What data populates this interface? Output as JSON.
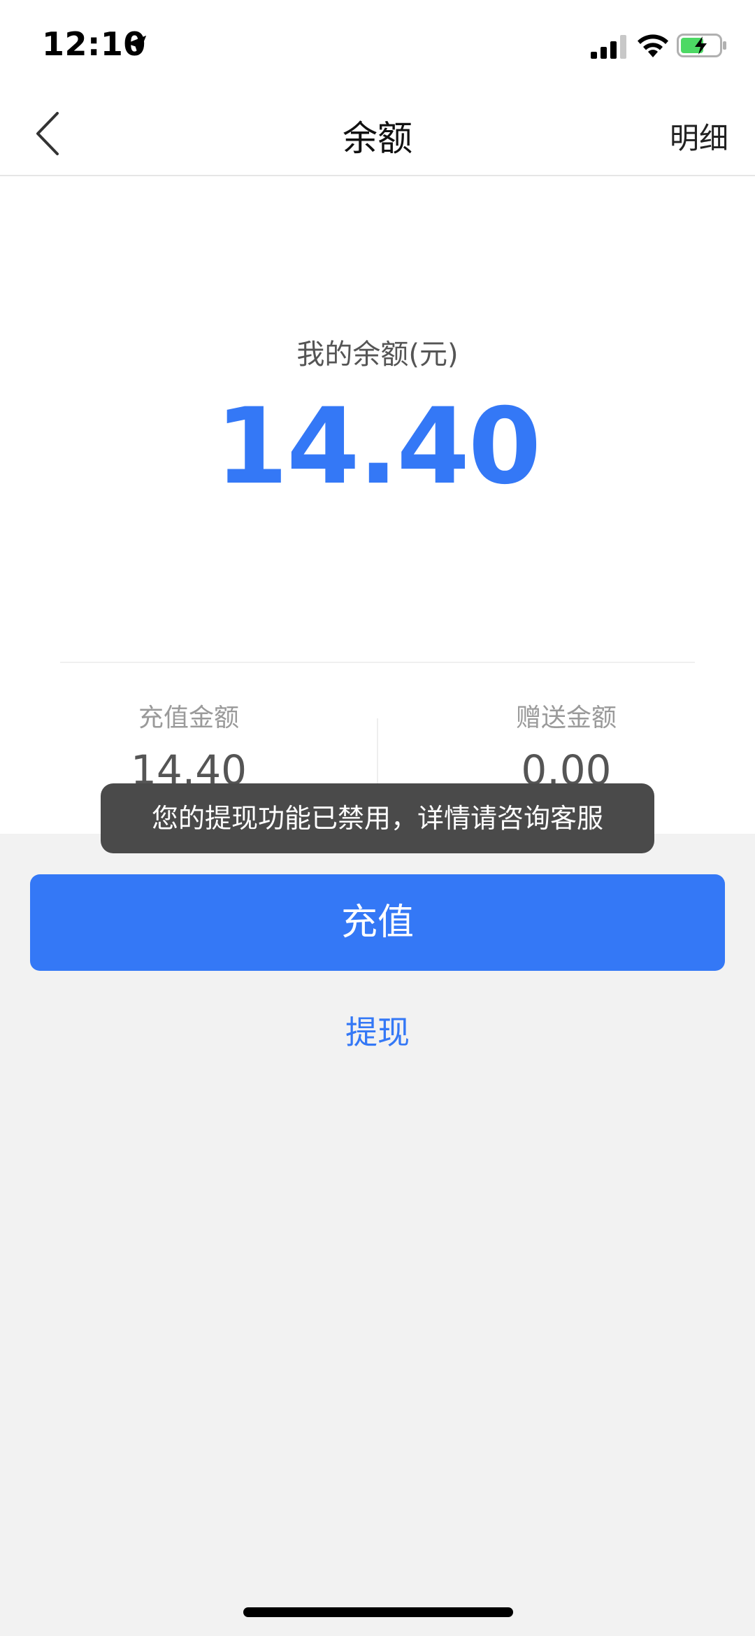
{
  "status_bar": {
    "time": "12:10",
    "icons": [
      "location-arrow-icon",
      "signal-icon",
      "wifi-icon",
      "battery-charging-icon"
    ]
  },
  "nav": {
    "title": "余额",
    "right_label": "明细",
    "back_icon": "chevron-left-icon"
  },
  "balance": {
    "label": "我的余额(元)",
    "value": "14.40"
  },
  "breakdown": {
    "recharge_label": "充值金额",
    "recharge_value": "14.40",
    "gift_label": "赠送金额",
    "gift_value": "0.00"
  },
  "toast": {
    "message": "您的提现功能已禁用，详情请咨询客服"
  },
  "actions": {
    "recharge_label": "充值",
    "withdraw_label": "提现"
  },
  "colors": {
    "accent": "#3478f6",
    "toast_bg": "#4a4a4a",
    "page_bg": "#f2f2f2"
  }
}
